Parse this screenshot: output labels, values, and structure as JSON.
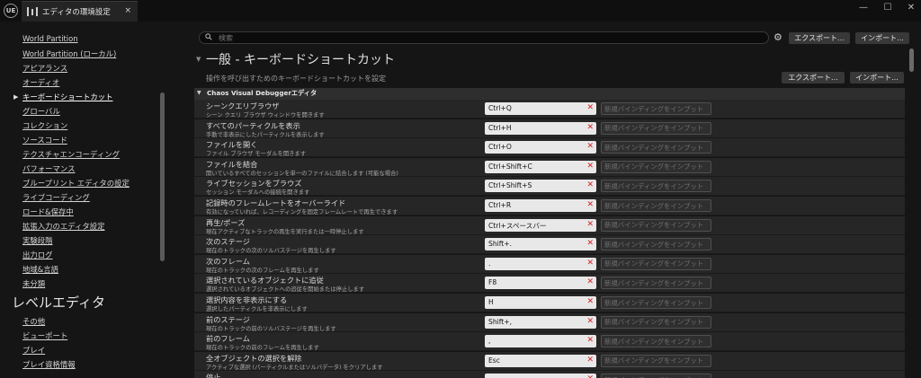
{
  "titlebar": {
    "logo": "UE",
    "tab_title": "エディタの環境設定",
    "tab_close": "×",
    "minimize": "—",
    "maximize": "☐",
    "close": "✕"
  },
  "sidebar": {
    "links": [
      "World Partition",
      "World Partition (ローカル)",
      "アピアランス",
      "オーディオ",
      "キーボードショートカット",
      "グローバル",
      "コレクション",
      "ソースコード",
      "テクスチャエンコーディング",
      "パフォーマンス",
      "ブループリント エディタの設定",
      "ライブコーディング",
      "ロード&保存中",
      "拡張入力のエディタ設定",
      "実験段階",
      "出力ログ",
      "地域&言語",
      "未分類"
    ],
    "active_index": 4,
    "heading": "レベルエディタ",
    "sub_links": [
      "その他",
      "ビューポート",
      "プレイ",
      "プレイ資格情報"
    ]
  },
  "search": {
    "placeholder": "検索"
  },
  "toolbar": {
    "export_label": "エクスポート...",
    "import_label": "インポート..."
  },
  "section": {
    "title": "一般 - キーボードショートカット",
    "description": "操作を呼び出すためのキーボードショートカットを設定",
    "export_label": "エクスポート...",
    "import_label": "インポート..."
  },
  "category": {
    "title": "Chaos Visual Debuggerエディタ"
  },
  "new_binding_placeholder": "新規バインディングをインプット",
  "shortcuts": [
    {
      "name": "シーンクエリブラウザ",
      "desc": "シーン クエリ ブラウザ ウィンドウを開きます",
      "key": "Ctrl+Q"
    },
    {
      "name": "すべてのパーティクルを表示",
      "desc": "手動で非表示にしたパーティクルを表示します",
      "key": "Ctrl+H"
    },
    {
      "name": "ファイルを開く",
      "desc": "ファイル ブラウザ モーダルを開きます",
      "key": "Ctrl+O"
    },
    {
      "name": "ファイルを結合",
      "desc": "開いているすべてのセッションを単一のファイルに結合します (可能な場合)",
      "key": "Ctrl+Shift+C"
    },
    {
      "name": "ライブセッションをブラウズ",
      "desc": "セッション モーダルへの接続を開きます",
      "key": "Ctrl+Shift+S"
    },
    {
      "name": "記録時のフレームレートをオーバーライド",
      "desc": "有効になっていれば、レコーディングを固定フレームレートで再生できます",
      "key": "Ctrl+R"
    },
    {
      "name": "再生/ポーズ",
      "desc": "現在アクティブなトラックの再生を実行または一時停止します",
      "key": "Ctrl+スペースバー"
    },
    {
      "name": "次のステージ",
      "desc": "現在のトラックの次のソルバステージを再生します",
      "key": "Shift+."
    },
    {
      "name": "次のフレーム",
      "desc": "現在のトラックの次のフレームを再生します",
      "key": "."
    },
    {
      "name": "選択されているオブジェクトに追従",
      "desc": "選択されているオブジェクトへの追従を開始または停止します",
      "key": "F8"
    },
    {
      "name": "選択内容を非表示にする",
      "desc": "選択したパーティクルを非表示にします",
      "key": "H"
    },
    {
      "name": "前のステージ",
      "desc": "現在のトラックの前のソルバステージを再生します",
      "key": "Shift+,"
    },
    {
      "name": "前のフレーム",
      "desc": "現在のトラックの前のフレームを再生します",
      "key": ","
    },
    {
      "name": "全オブジェクトの選択を解除",
      "desc": "アクティブな選択 (パーティクルまたはソルバデータ) をクリアします",
      "key": "Esc"
    },
    {
      "name": "停止",
      "desc": "",
      "key": ""
    }
  ],
  "colors": {
    "clear_icon": "#d62020",
    "background": "#151515",
    "row": "#262626"
  }
}
